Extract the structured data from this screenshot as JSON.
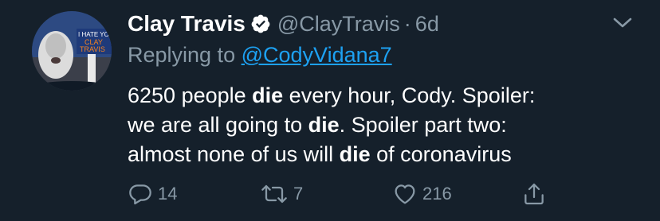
{
  "tweet": {
    "display_name": "Clay Travis",
    "handle": "@ClayTravis",
    "separator": "·",
    "time": "6d",
    "replying_prefix": "Replying to",
    "replying_to": "@CodyVidana7",
    "body": {
      "line1_a": "6250 people ",
      "line1_b": "die",
      "line1_c": " every hour, Cody. Spoiler:",
      "line2_a": "we are all going to ",
      "line2_b": "die",
      "line2_c": ". Spoiler part two:",
      "line3_a": "almost none of us will ",
      "line3_b": "die",
      "line3_c": " of coronavirus"
    },
    "avatar_sign": {
      "line1": "I HATE YOU",
      "line2": "CLAY",
      "line3": "TRAVIS"
    },
    "actions": {
      "reply_count": "14",
      "retweet_count": "7",
      "like_count": "216"
    }
  },
  "colors": {
    "background": "#15202b",
    "text": "#ffffff",
    "muted": "#8899a6",
    "link": "#1da1f2"
  },
  "icons": {
    "verified": "verified-badge-icon",
    "caret": "chevron-down-icon",
    "reply": "reply-icon",
    "retweet": "retweet-icon",
    "like": "heart-icon",
    "share": "share-icon"
  }
}
